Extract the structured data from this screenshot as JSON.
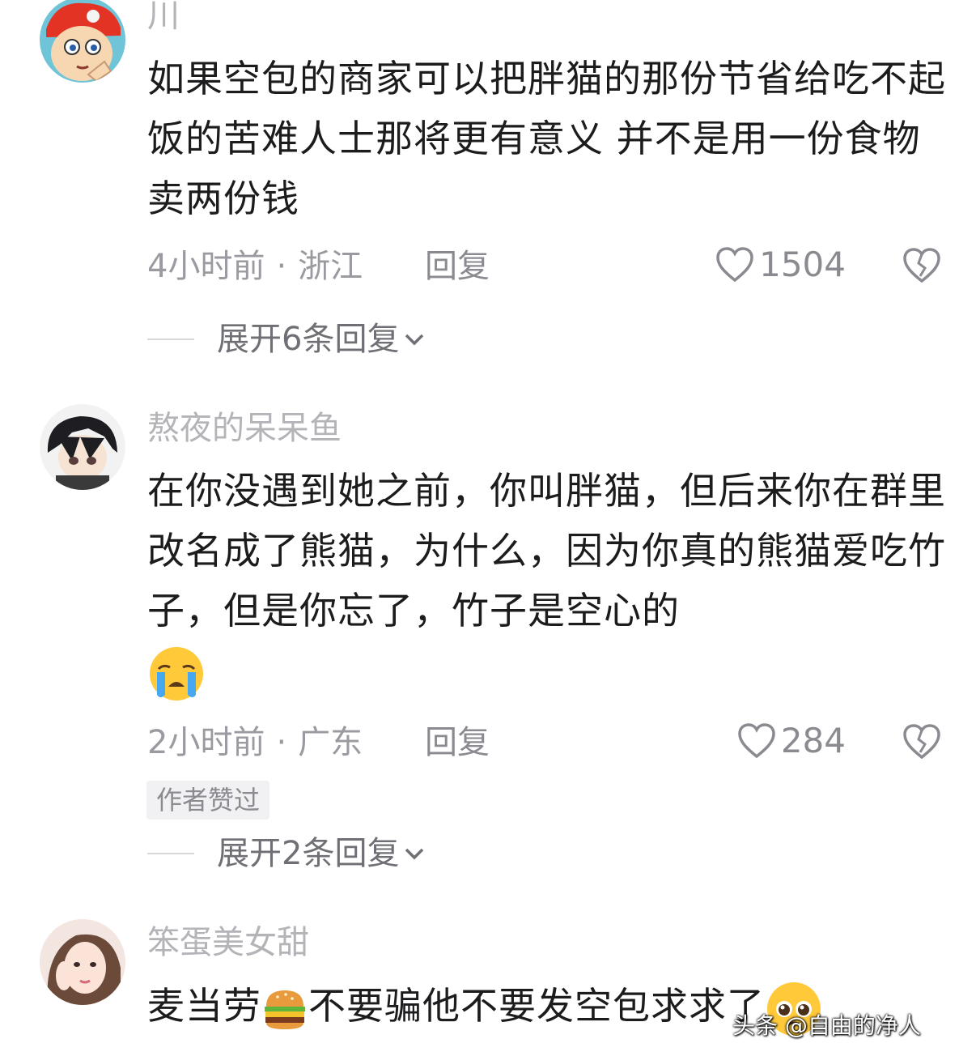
{
  "comments": [
    {
      "username": "川",
      "text": "如果空包的商家可以把胖猫的那份节省给吃不起饭的苦难人士那将更有意义 并不是用一份食物卖两份钱",
      "time": "4小时前",
      "location": "浙江",
      "reply_label": "回复",
      "likes": "1504",
      "expand_label": "展开6条回复"
    },
    {
      "username": "熬夜的呆呆鱼",
      "text": "在你没遇到她之前，你叫胖猫，但后来你在群里改名成了熊猫，为什么，因为你真的熊猫爱吃竹子，但是你忘了，竹子是空心的",
      "time": "2小时前",
      "location": "广东",
      "reply_label": "回复",
      "likes": "284",
      "badge": "作者赞过",
      "expand_label": "展开2条回复"
    },
    {
      "username": "笨蛋美女甜",
      "text_part1": "麦当劳",
      "text_part2": "不要骗他不要发空包求求了"
    }
  ],
  "watermark": "头条 @自由的净人",
  "icons": [
    "heart-icon",
    "broken-heart-icon",
    "chevron-down-icon",
    "crying-emoji",
    "burger-emoji",
    "pleading-emoji"
  ]
}
